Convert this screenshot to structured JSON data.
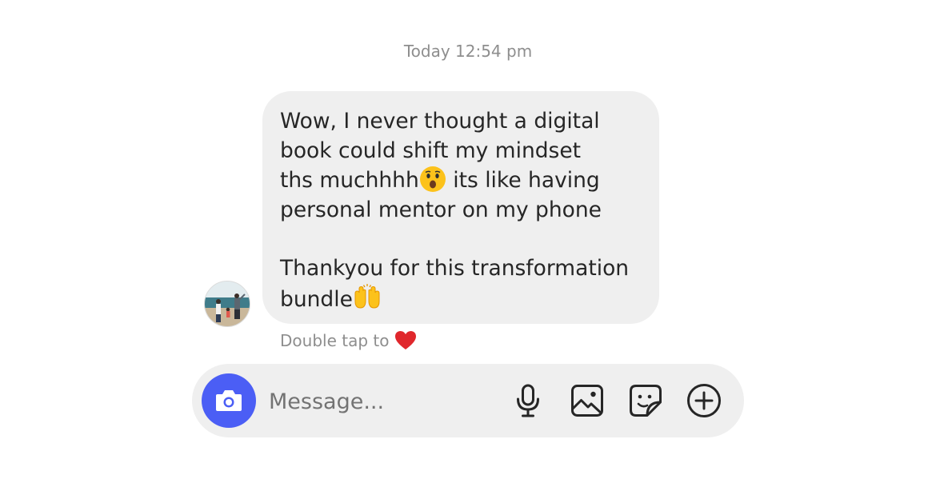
{
  "chat": {
    "timestamp": "Today 12:54 pm",
    "message": {
      "line1": "Wow, I never thought a digital",
      "line2": "book could shift my mindset",
      "line3_a": "ths muchhhh",
      "line3_b": " its like having",
      "line4": "personal mentor on my phone",
      "line5": "Thankyou for this transformation",
      "line6": "bundle"
    },
    "emojis": {
      "surprised": "hushed-face",
      "raised_hands": "raising-hands"
    },
    "hint": {
      "text": "Double tap to",
      "icon": "heart-icon"
    }
  },
  "composer": {
    "placeholder": "Message...",
    "icons": [
      "camera-icon",
      "microphone-icon",
      "gallery-icon",
      "sticker-icon",
      "plus-icon"
    ]
  },
  "colors": {
    "accent": "#4b5ef5",
    "bubble": "#efefef",
    "heart": "#e0272c",
    "muted_text": "#8e8e8e"
  }
}
